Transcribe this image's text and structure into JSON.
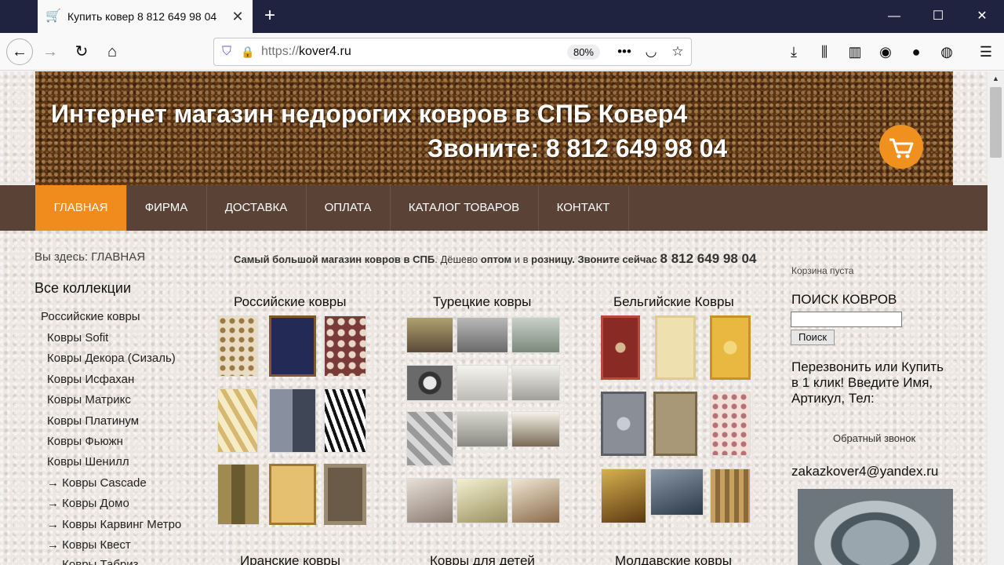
{
  "browser": {
    "tab_title": "Купить ковер 8 812 649 98 04",
    "url_scheme": "https://",
    "url_host": "kover4.ru",
    "zoom": "80%"
  },
  "site": {
    "title": "Интернет магазин недорогих ковров в СПБ Ковер4",
    "phone_banner": "Звоните: 8 812 649 98 04",
    "menu": [
      "ГЛАВНАЯ",
      "ФИРМА",
      "ДОСТАВКА",
      "ОПЛАТА",
      "КАТАЛОГ ТОВАРОВ",
      "КОНТАКТ"
    ],
    "breadcrumb": "Вы здесь: ГЛАВНАЯ",
    "sidebar_heading": "Все коллекции",
    "sidebar_items": [
      "Российские ковры",
      "Ковры Sofit",
      "Ковры Декора (Сизаль)",
      "Ковры Исфахан",
      "Ковры Матрикс",
      "Ковры Платинум",
      "Ковры Фьюжн",
      "Ковры Шенилл",
      "→ Ковры Cascade",
      "→ Ковры Домо",
      "→ Ковры Карвинг Метро",
      "→ Ковры Квест",
      "→ Ковры Табриз"
    ],
    "promo": {
      "p1": "Самый большой магазин ковров в СПБ",
      "p2": ". Дёшево ",
      "p3": "оптом",
      "p4": " и в ",
      "p5": "розницу",
      "p6": ". Звоните сейчас ",
      "phone": "8 812 649 98 04"
    },
    "categories": [
      "Российские ковры",
      "Турецкие ковры",
      "Бельгийские Ковры",
      "Иранские ковры",
      "Ковры для детей",
      "Молдавские ковры"
    ],
    "cart": "Корзина пуста",
    "search_heading": "ПОИСК КОВРОВ",
    "search_button": "Поиск",
    "callback_text": "Перезвонить или Купить в 1 клик! Введите Имя, Артикул, Тел:",
    "callback_link": "Обратный звонок",
    "email": "zakazkover4@yandex.ru"
  }
}
